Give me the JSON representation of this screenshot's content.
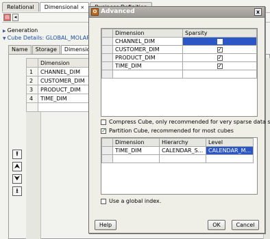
{
  "editor": {
    "tabs": [
      {
        "label": "Relational"
      },
      {
        "label": "Dimensional"
      },
      {
        "label": "Business Definition"
      }
    ],
    "close_glyph": "×",
    "generation_label": "Generation",
    "cube_details_label": "Cube Details: GLOBAL_MOLAP_T",
    "subtabs": [
      {
        "label": "Name"
      },
      {
        "label": "Storage"
      },
      {
        "label": "Dimensions"
      }
    ],
    "grid": {
      "header": "Dimension",
      "rows": [
        {
          "num": "1",
          "name": "CHANNEL_DIM"
        },
        {
          "num": "2",
          "name": "CUSTOMER_DIM"
        },
        {
          "num": "3",
          "name": "PRODUCT_DIM"
        },
        {
          "num": "4",
          "name": "TIME_DIM"
        }
      ]
    },
    "side_buttons": [
      "⭱",
      "⮝",
      "⮟",
      "⭳"
    ]
  },
  "dialog": {
    "title": "Advanced",
    "close_label": "x",
    "sparsity_table": {
      "headers": [
        "Dimension",
        "Sparsity"
      ],
      "rows": [
        {
          "dimension": "CHANNEL_DIM",
          "sparse": true
        },
        {
          "dimension": "CUSTOMER_DIM",
          "sparse": true
        },
        {
          "dimension": "PRODUCT_DIM",
          "sparse": true
        },
        {
          "dimension": "TIME_DIM",
          "sparse": true
        }
      ]
    },
    "compress_label": "Compress Cube, only recommended for very sparse data sets",
    "compress_checked": false,
    "partition_label": "Partition Cube, recommended for most cubes",
    "partition_checked": true,
    "partition_table": {
      "headers": [
        "Dimension",
        "Hierarchy",
        "Level"
      ],
      "rows": [
        {
          "dimension": "TIME_DIM",
          "hierarchy": "CALENDAR_S...",
          "level": "CALENDAR_M..."
        }
      ]
    },
    "global_index_label": "Use a global index.",
    "global_index_checked": false,
    "help_label": "Help",
    "ok_label": "OK",
    "cancel_label": "Cancel"
  },
  "colors": {
    "selection": "#2a56c6",
    "title_bar": "#a9a6a2",
    "link": "#1c4ea0"
  }
}
